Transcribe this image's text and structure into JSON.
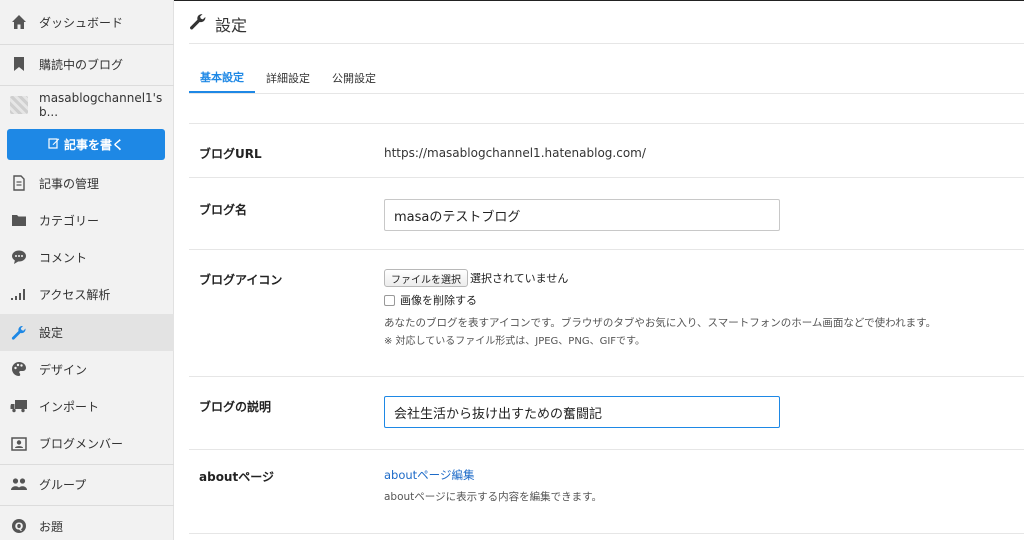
{
  "sidebar": {
    "items": [
      {
        "label": "ダッシュボード",
        "icon": "home-icon"
      },
      {
        "label": "購読中のブログ",
        "icon": "bookmark-icon"
      },
      {
        "label": "masablogchannel1's b...",
        "icon": "blog-thumbnail-icon"
      },
      {
        "label": "記事の管理",
        "icon": "document-icon"
      },
      {
        "label": "カテゴリー",
        "icon": "folder-icon"
      },
      {
        "label": "コメント",
        "icon": "comment-icon"
      },
      {
        "label": "アクセス解析",
        "icon": "bar-chart-icon"
      },
      {
        "label": "設定",
        "icon": "wrench-icon",
        "active": true
      },
      {
        "label": "デザイン",
        "icon": "palette-icon"
      },
      {
        "label": "インポート",
        "icon": "truck-icon"
      },
      {
        "label": "ブログメンバー",
        "icon": "members-icon"
      },
      {
        "label": "グループ",
        "icon": "group-icon"
      },
      {
        "label": "お題",
        "icon": "q-badge-icon"
      }
    ],
    "write_button": "記事を書く"
  },
  "header": {
    "title": "設定"
  },
  "tabs": [
    {
      "label": "基本設定",
      "active": true
    },
    {
      "label": "詳細設定"
    },
    {
      "label": "公開設定"
    }
  ],
  "form": {
    "blog_url": {
      "label": "ブログURL",
      "value": "https://masablogchannel1.hatenablog.com/"
    },
    "blog_name": {
      "label": "ブログ名",
      "value": "masaのテストブログ"
    },
    "blog_icon": {
      "label": "ブログアイコン",
      "file_button": "ファイルを選択",
      "file_status": "選択されていません",
      "delete_checkbox": "画像を削除する",
      "help": "あなたのブログを表すアイコンです。ブラウザのタブやお気に入り、スマートフォンのホーム画面などで使われます。",
      "note": "※ 対応しているファイル形式は、JPEG、PNG、GIFです。"
    },
    "blog_description": {
      "label": "ブログの説明",
      "value": "会社生活から抜け出すための奮闘記"
    },
    "about_page": {
      "label": "aboutページ",
      "link": "aboutページ編集",
      "help": "aboutページに表示する内容を編集できます。"
    }
  },
  "colors": {
    "accent": "#1e88e5",
    "link": "#1e6bc8",
    "sidebar_bg": "#f2f2f2"
  }
}
